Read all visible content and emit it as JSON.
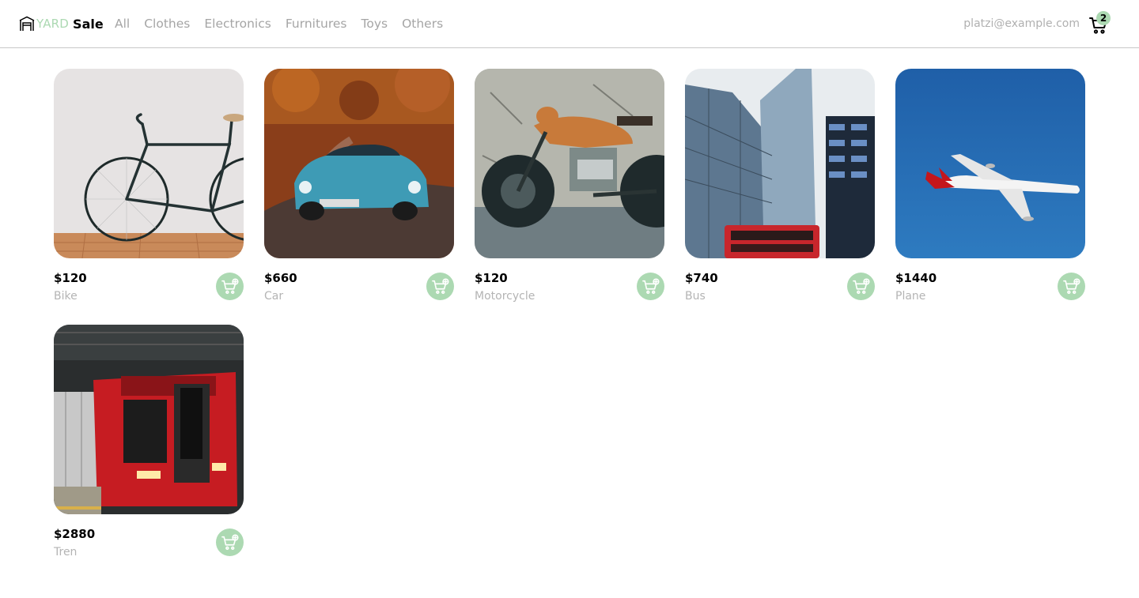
{
  "brand": {
    "yard": "YARD",
    "sale": "Sale",
    "logo_icon": "store-icon"
  },
  "nav": {
    "links": [
      "All",
      "Clothes",
      "Electronics",
      "Furnitures",
      "Toys",
      "Others"
    ],
    "email": "platzi@example.com",
    "cart_count": "2",
    "cart_icon": "shopping-cart-icon"
  },
  "colors": {
    "accent": "#acd9b2",
    "muted_text": "#a5a5a5",
    "divider": "#c8c8c8"
  },
  "products": [
    {
      "price": "$120",
      "name": "Bike"
    },
    {
      "price": "$660",
      "name": "Car"
    },
    {
      "price": "$120",
      "name": "Motorcycle"
    },
    {
      "price": "$740",
      "name": "Bus"
    },
    {
      "price": "$1440",
      "name": "Plane"
    },
    {
      "price": "$2880",
      "name": "Tren"
    }
  ],
  "add_to_cart_icon": "add-to-cart-icon"
}
